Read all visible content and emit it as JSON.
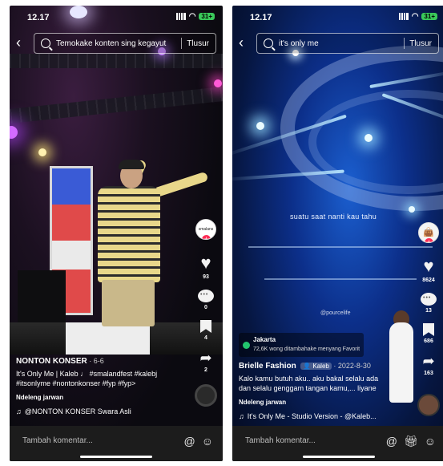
{
  "left": {
    "status": {
      "time": "12.17",
      "battery": "31+"
    },
    "search": {
      "query": "Temokake konten sing kegayut",
      "button": "Tlusur"
    },
    "rail": {
      "avatar_text": "smalans",
      "likes": "93",
      "comments": "0",
      "saves": "4",
      "shares": "2"
    },
    "post": {
      "author": "NONTON KONSER",
      "date": "· 6-6",
      "caption_line1": "It's Only Me | Kaleb ♩ #smalandfest #kalebj",
      "caption_line2": "#itsonlyme #nontonkonser #fyp #fyp>",
      "listen": "Ndeleng jarwan",
      "music": "@NONTON KONSER Swara Asli"
    },
    "comment_placeholder": "Tambah komentar...",
    "icons": [
      "at-icon",
      "emoji-icon"
    ]
  },
  "right": {
    "status": {
      "time": "12.17",
      "battery": "31+"
    },
    "search": {
      "query": "it's only me",
      "button": "Tlusur"
    },
    "lyric": "suatu saat nanti kau tahu",
    "watermark": "@pourcelife",
    "rail": {
      "likes": "8624",
      "comments": "13",
      "saves": "686",
      "shares": "163"
    },
    "location": {
      "city": "Jakarta",
      "sub": "72,6K wong ditambahake menyang Favorit"
    },
    "post": {
      "author": "Brielle Fashion",
      "tag": "Kaleb",
      "date": "· 2022-8-30",
      "caption_line1": "Kalo kamu butuh aku.. aku bakal selalu ada",
      "caption_line2": "dan selalu genggam tangan kamu,... liyane",
      "listen": "Ndeleng jarwan",
      "music": "It's Only Me - Studio Version - @Kaleb..."
    },
    "comment_placeholder": "Tambah komentar...",
    "icons": [
      "at-icon",
      "gift-icon",
      "emoji-icon"
    ]
  }
}
